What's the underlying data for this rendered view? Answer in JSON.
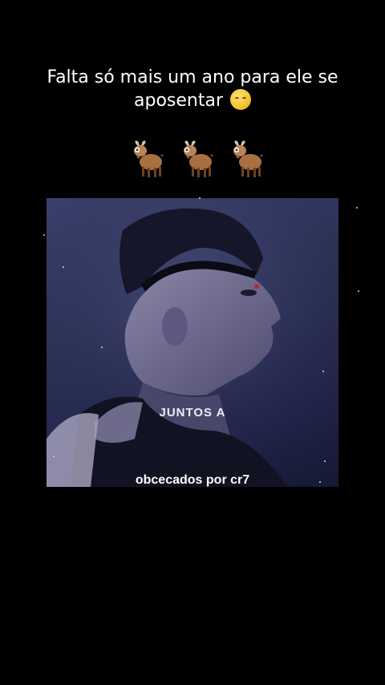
{
  "caption": {
    "text": "Falta só mais um ano para ele se aposentar",
    "emoji": "pensive-face-icon"
  },
  "goats": [
    "goat-icon",
    "goat-icon",
    "goat-icon"
  ],
  "video": {
    "overlay_line1": "JUNTOS A",
    "overlay_line2": "",
    "watermark": "obcecados por cr7"
  },
  "colors": {
    "background": "#000000",
    "video_tint": "#2c3158",
    "overlay_accent": "#3a55c8"
  }
}
